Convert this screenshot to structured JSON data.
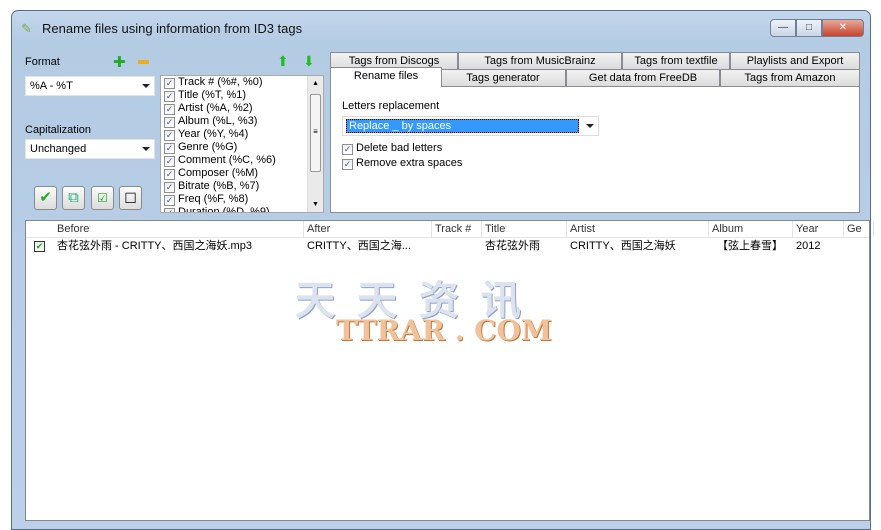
{
  "window": {
    "title": "Rename files using information from ID3 tags",
    "icon": "rename-tags-icon"
  },
  "left": {
    "format_label": "Format",
    "format_value": "%A - %T",
    "capitalization_label": "Capitalization",
    "capitalization_value": "Unchanged",
    "fields": [
      "Track # (%#, %0)",
      "Title (%T, %1)",
      "Artist (%A, %2)",
      "Album (%L, %3)",
      "Year (%Y, %4)",
      "Genre (%G)",
      "Comment (%C, %6)",
      "Composer (%M)",
      "Bitrate (%B, %7)",
      "Freq (%F, %8)",
      "Duration (%D, %9)"
    ]
  },
  "tabs": {
    "row1": [
      "Tags from Discogs",
      "Tags from MusicBrainz",
      "Tags from textfile",
      "Playlists and Export"
    ],
    "row2": [
      "Rename files",
      "Tags generator",
      "Get data from FreeDB",
      "Tags from Amazon"
    ],
    "selected": "Rename files"
  },
  "panel": {
    "letters_label": "Letters replacement",
    "letters_value": "Replace _ by spaces",
    "delete_bad": "Delete bad letters",
    "remove_spaces": "Remove extra spaces"
  },
  "filelist": {
    "columns": [
      "Before",
      "After",
      "Track #",
      "Title",
      "Artist",
      "Album",
      "Year",
      "Ge"
    ],
    "rows": [
      {
        "checked": true,
        "cells": [
          "杏花弦外雨 - CRITTY、西国之海妖.mp3",
          "CRITTY、西国之海...",
          "",
          "杏花弦外雨",
          "CRITTY、西国之海妖",
          "【弦上春雪】",
          "2012",
          ""
        ]
      }
    ]
  },
  "watermark": {
    "line1": "天 天 资 讯",
    "line2": "TTRAR . COM"
  },
  "colors": {
    "selection": "#3399ff",
    "title_bar": "#bcd1e9"
  }
}
